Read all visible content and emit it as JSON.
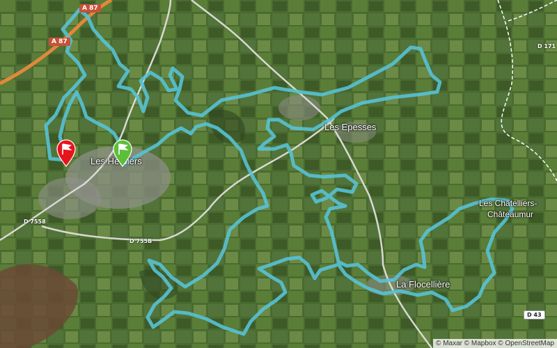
{
  "map": {
    "places": {
      "les_herbiers": "Les Herbiers",
      "les_epesses": "Les Epesses",
      "la_flocelliere": "La Flocellière",
      "les_chatelliers_line1": "Les Châtelliers-",
      "les_chatelliers_line2": "Châteaumur"
    },
    "roads": {
      "a87_top": "A 87",
      "a87_left": "A 87",
      "d7558": "D 7558",
      "d755b": "D 755B",
      "d171": "D 171",
      "d43": "D 43"
    },
    "markers": {
      "start_color": "#5bbf3a",
      "finish_color": "#e8141c"
    },
    "route_color": "#56c2d6",
    "attribution": "© Maxar © Mapbox © OpenStreetMap"
  }
}
